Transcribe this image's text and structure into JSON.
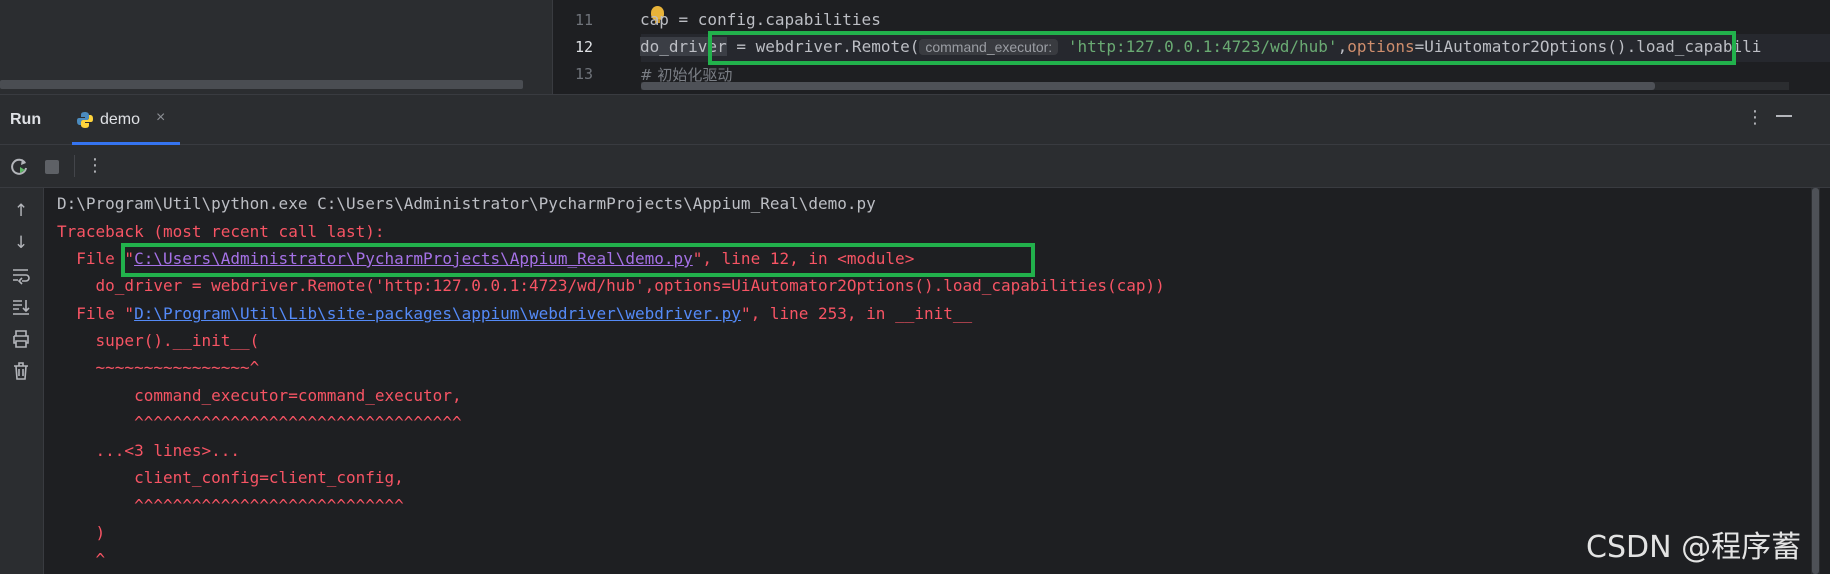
{
  "editor": {
    "lines": [
      {
        "number": "11",
        "text": "cap = config.capabilities"
      },
      {
        "number": "12",
        "var": "do_driver",
        "rest": " = webdriver.Remote(",
        "hint": "command_executor:",
        "url": "'http:127.0.0.1:4723/wd/hub'",
        "after_url": ",",
        "options_kw": "options",
        "options_rest": "=UiAutomator2Options().load_capabili"
      },
      {
        "number": "13",
        "text": "# 初始化驱动"
      }
    ]
  },
  "run_panel": {
    "title": "Run",
    "tab_label": "demo",
    "tab_close": "×",
    "more_icon": "⋮",
    "toolbar_more": "⋮"
  },
  "console": {
    "lines": [
      {
        "type": "normal",
        "text": "D:\\Program\\Util\\python.exe C:\\Users\\Administrator\\PycharmProjects\\Appium_Real\\demo.py"
      },
      {
        "type": "err",
        "text": "Traceback (most recent call last):"
      },
      {
        "type": "err-file",
        "prefix": "  File \"",
        "link": "C:\\Users\\Administrator\\PycharmProjects\\Appium_Real\\demo.py",
        "suffix": "\", line 12, in <module>"
      },
      {
        "type": "err",
        "text": "    do_driver = webdriver.Remote('http:127.0.0.1:4723/wd/hub',options=UiAutomator2Options().load_capabilities(cap))"
      },
      {
        "type": "err-file",
        "prefix": "  File \"",
        "link": "D:\\Program\\Util\\Lib\\site-packages\\appium\\webdriver\\webdriver.py",
        "suffix": "\", line 253, in __init__"
      },
      {
        "type": "err",
        "text": "    super().__init__("
      },
      {
        "type": "err",
        "text": "    ~~~~~~~~~~~~~~~~^"
      },
      {
        "type": "err",
        "text": "        command_executor=command_executor,"
      },
      {
        "type": "err",
        "text": "        ^^^^^^^^^^^^^^^^^^^^^^^^^^^^^^^^^^"
      },
      {
        "type": "err",
        "text": "    ...<3 lines>..."
      },
      {
        "type": "err",
        "text": "        client_config=client_config,"
      },
      {
        "type": "err",
        "text": "        ^^^^^^^^^^^^^^^^^^^^^^^^^^^^"
      },
      {
        "type": "err",
        "text": "    )"
      },
      {
        "type": "err",
        "text": "    ^"
      }
    ]
  },
  "watermark": "CSDN @程序蓄",
  "colors": {
    "background": "#1e1f22",
    "panel": "#2b2d30",
    "error_text": "#f75464",
    "link": "#548af7",
    "highlight_box": "#22b14c",
    "string": "#6aab73"
  }
}
